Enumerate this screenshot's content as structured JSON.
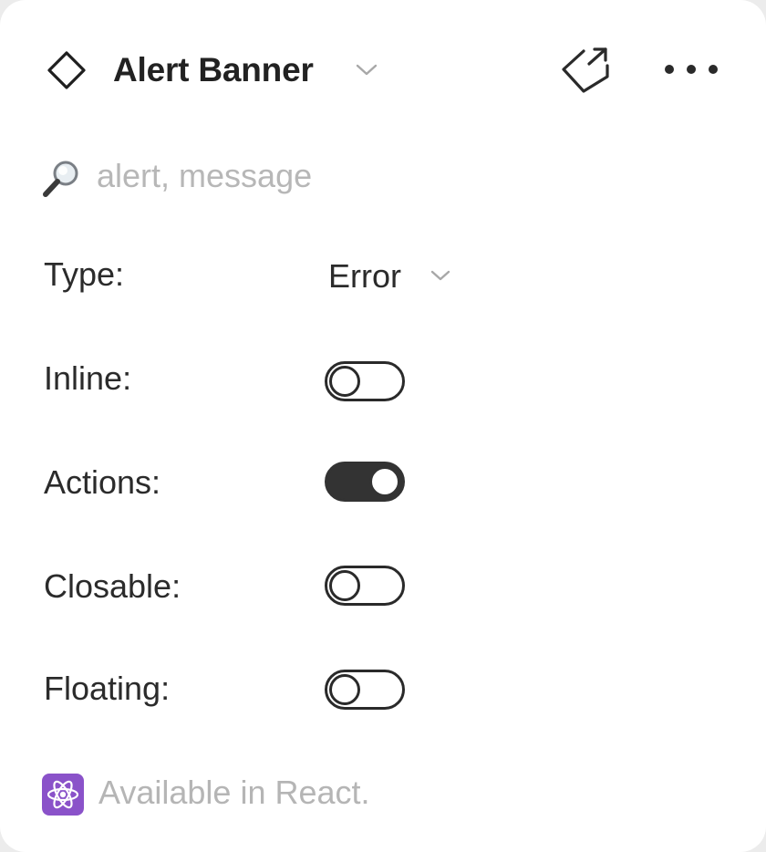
{
  "component": {
    "title": "Alert Banner",
    "icon": "component-diamond-icon"
  },
  "header": {
    "title_menu_icon": "chevron-down-icon",
    "open_icon": "open-in-new-tag-icon",
    "more_icon": "more-horizontal-icon"
  },
  "search": {
    "placeholder": "alert, message",
    "value": "",
    "icon": "magnifier-icon"
  },
  "properties": [
    {
      "label": "Type:",
      "control": "select",
      "value": "Error"
    },
    {
      "label": "Inline:",
      "control": "toggle",
      "checked": false
    },
    {
      "label": "Actions:",
      "control": "toggle",
      "checked": true
    },
    {
      "label": "Closable:",
      "control": "toggle",
      "checked": false
    },
    {
      "label": "Floating:",
      "control": "toggle",
      "checked": false
    }
  ],
  "footer": {
    "icon": "react-atom-icon",
    "icon_color": "#8a52c9",
    "text": "Available in React."
  },
  "colors": {
    "toggle_on": "#333333",
    "placeholder": "#b7b7b7",
    "footer_text": "#b5b5b5"
  }
}
